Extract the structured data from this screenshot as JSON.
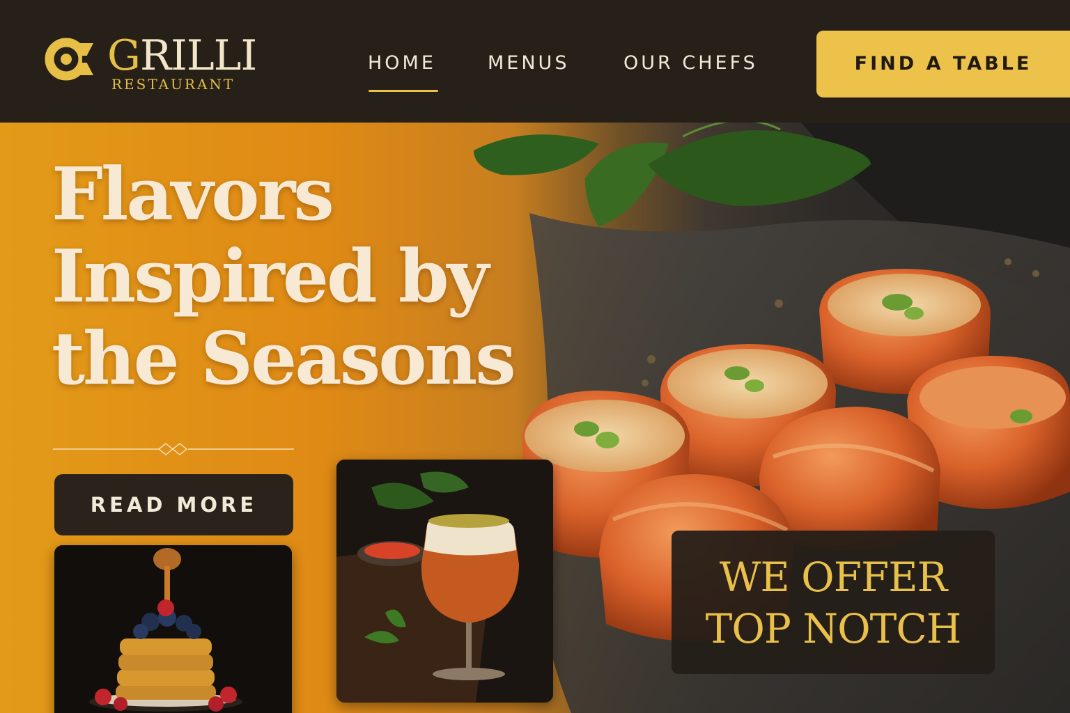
{
  "brand": {
    "initial": "G",
    "name_rest": "RILLI",
    "subtitle": "RESTAURANT",
    "logo_icon": "logo-mark-icon"
  },
  "nav": {
    "items": [
      {
        "label": "HOME",
        "active": true
      },
      {
        "label": "MENUS",
        "active": false
      },
      {
        "label": "OUR CHEFS",
        "active": false
      }
    ],
    "cta_label": "FIND A TABLE"
  },
  "hero": {
    "headline_lines": [
      "Flavors",
      "Inspired by",
      "the Seasons"
    ],
    "read_more_label": "READ MORE",
    "offer_lines": [
      "WE OFFER",
      "TOP NOTCH"
    ]
  },
  "images": {
    "main": "glazed-dumplings-photo",
    "card_1": "pancake-stack-photo",
    "card_2": "cocktail-glass-photo"
  },
  "colors": {
    "header_bg": "#262019",
    "accent_gold": "#ecc24b",
    "hero_orange": "#e39a18",
    "dark_panel": "#2a221b",
    "cream_text": "#f8e9d4"
  }
}
